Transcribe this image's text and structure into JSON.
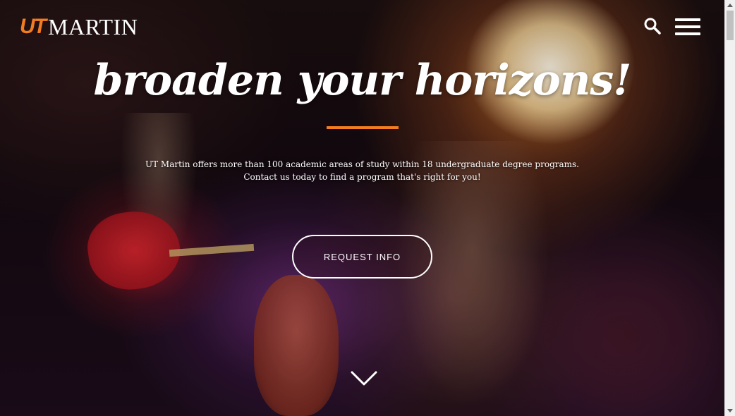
{
  "header": {
    "logo_ut": "UT",
    "logo_martin": "MARTIN",
    "search_icon": "search-icon",
    "menu_icon": "hamburger-menu-icon"
  },
  "hero": {
    "headline": "broaden your horizons!",
    "intro_line_1": "UT Martin offers more than 100 academic areas of study within 18 undergraduate degree programs.",
    "intro_line_2": "Contact us today to find a program that's right for you!",
    "cta_label": "REQUEST INFO",
    "scroll_icon": "chevron-down-icon"
  },
  "colors": {
    "brand_orange": "#f47c20",
    "text": "#ffffff"
  }
}
